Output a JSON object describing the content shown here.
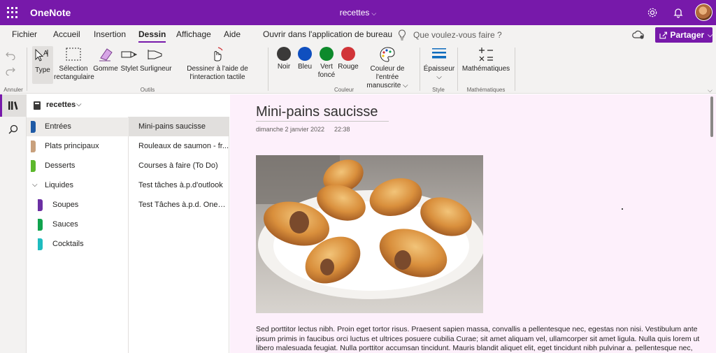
{
  "titlebar": {
    "app_name": "OneNote",
    "doc_title": "recettes",
    "icons": [
      "waffle-icon",
      "settings-icon",
      "bell-icon"
    ]
  },
  "tabs": [
    "Fichier",
    "Accueil",
    "Insertion",
    "Dessin",
    "Affichage",
    "Aide",
    "Ouvrir dans l'application de bureau"
  ],
  "active_tab": "Dessin",
  "tellme_placeholder": "Que voulez-vous faire ?",
  "share_label": "Partager",
  "ribbon": {
    "undo_group": "Annuler",
    "outils": {
      "label": "Outils",
      "items": [
        "Type",
        "Sélection rectangulaire",
        "Gomme",
        "Stylet",
        "Surligneur",
        "Dessiner à l'aide de l'interaction tactile"
      ]
    },
    "couleur": {
      "label": "Couleur",
      "colors": [
        {
          "name": "Noir",
          "hex": "#3b3a39"
        },
        {
          "name": "Bleu",
          "hex": "#0f4fbf"
        },
        {
          "name": "Vert foncé",
          "hex": "#0e8a2c"
        },
        {
          "name": "Rouge",
          "hex": "#d13438"
        }
      ],
      "ink_color_label": "Couleur de l'entrée manuscrite"
    },
    "style": {
      "label": "Style",
      "item": "Épaisseur"
    },
    "math": {
      "label": "Mathématiques",
      "item": "Mathématiques"
    }
  },
  "notebook": {
    "name": "recettes",
    "sections": [
      {
        "name": "Entrées",
        "color": "#1f5aa6",
        "indent": false
      },
      {
        "name": "Plats principaux",
        "color": "#c8a07c",
        "indent": false
      },
      {
        "name": "Desserts",
        "color": "#5cb82c",
        "indent": false
      },
      {
        "name": "Liquides",
        "group": true
      },
      {
        "name": "Soupes",
        "color": "#6b2fa3",
        "indent": true
      },
      {
        "name": "Sauces",
        "color": "#10a34e",
        "indent": true
      },
      {
        "name": "Cocktails",
        "color": "#1fbcbf",
        "indent": true
      }
    ],
    "pages": [
      "Mini-pains saucisse",
      "Rouleaux de saumon - fr...",
      "Courses à faire (To Do)",
      "Test tâches à.p.d'outlook",
      "Test Tâches à.p.d. OneNo..."
    ]
  },
  "page": {
    "title": "Mini-pains saucisse",
    "date": "dimanche 2 janvier 2022",
    "time": "22:38",
    "body": "Sed porttitor lectus nibh. Proin eget tortor risus. Praesent sapien massa, convallis a pellentesque nec, egestas non nisi. Vestibulum ante ipsum primis in faucibus orci luctus et ultrices posuere cubilia Curae; sit amet aliquam vel, ullamcorper sit amet ligula. Nulla quis lorem ut libero malesuada feugiat. Nulla porttitor accumsan tincidunt. Mauris blandit aliquet elit, eget tincidunt nibh pulvinar a. pellentesque nec, egestas non nisi. Vestibulum ante ipsum primis in faucibus orci luctus et ultrices posuere cubilia Curae; Donec velit neque,"
  }
}
